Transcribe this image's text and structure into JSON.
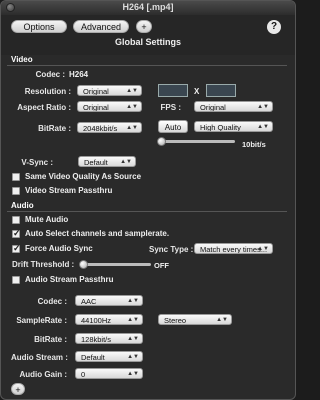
{
  "window": {
    "title": "H264 [.mp4]"
  },
  "toolbar": {
    "options_label": "Options",
    "advanced_label": "Advanced",
    "add_label": "+",
    "help_label": "?"
  },
  "page_title": "Global Settings",
  "video": {
    "section_label": "Video",
    "codec_label": "Codec :",
    "codec_value": "H264",
    "resolution_label": "Resolution :",
    "resolution_value": "Original",
    "x_separator": "X",
    "aspect_label": "Aspect Ratio :",
    "aspect_value": "Original",
    "fps_label": "FPS :",
    "fps_value": "Original",
    "bitrate_label": "BitRate :",
    "bitrate_value": "2048kbit/s",
    "auto_label": "Auto",
    "quality_value": "High Quality",
    "quality_readout": "10bit/s",
    "quality_level": 0.0,
    "vsync_label": "V-Sync :",
    "vsync_value": "Default",
    "same_quality_label": "Same Video Quality As Source",
    "same_quality_checked": false,
    "passthru_label": "Video Stream Passthru",
    "passthru_checked": false
  },
  "audio": {
    "section_label": "Audio",
    "mute_label": "Mute Audio",
    "mute_checked": false,
    "auto_select_label": "Auto Select channels and samplerate.",
    "auto_select_checked": true,
    "force_sync_label": "Force Audio Sync",
    "force_sync_checked": true,
    "sync_type_label": "Sync Type :",
    "sync_type_value": "Match every times...",
    "drift_label": "Drift Threshold :",
    "drift_readout": "OFF",
    "drift_level": 0.0,
    "passthru_label": "Audio Stream Passthru",
    "passthru_checked": false,
    "codec_label": "Codec :",
    "codec_value": "AAC",
    "samplerate_label": "SampleRate :",
    "samplerate_value": "44100Hz",
    "channels_value": "Stereo",
    "bitrate_label": "BitRate :",
    "bitrate_value": "128kbit/s",
    "stream_label": "Audio Stream :",
    "stream_value": "Default",
    "gain_label": "Audio Gain :",
    "gain_value": "0"
  },
  "footer": {
    "add_label": "+"
  }
}
